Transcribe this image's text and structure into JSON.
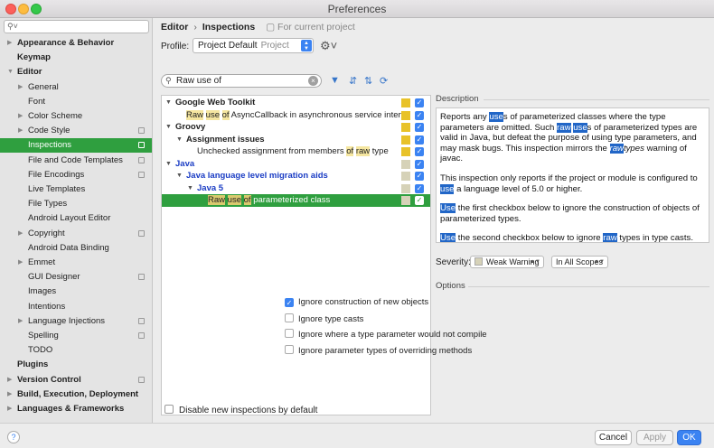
{
  "window": {
    "title": "Preferences"
  },
  "sidebar": {
    "search_placeholder": "",
    "items": [
      {
        "label": "Appearance & Behavior",
        "level": 0,
        "bold": true,
        "arrow": true,
        "page_icon": false
      },
      {
        "label": "Keymap",
        "level": 0,
        "bold": true,
        "arrow": false,
        "page_icon": false
      },
      {
        "label": "Editor",
        "level": 0,
        "bold": true,
        "arrow": true,
        "expanded": true,
        "page_icon": false
      },
      {
        "label": "General",
        "level": 1,
        "arrow": true,
        "page_icon": false
      },
      {
        "label": "Font",
        "level": 1,
        "arrow": false,
        "page_icon": false
      },
      {
        "label": "Color Scheme",
        "level": 1,
        "arrow": true,
        "page_icon": false
      },
      {
        "label": "Code Style",
        "level": 1,
        "arrow": true,
        "page_icon": true
      },
      {
        "label": "Inspections",
        "level": 1,
        "arrow": false,
        "page_icon": true,
        "selected": true
      },
      {
        "label": "File and Code Templates",
        "level": 1,
        "arrow": false,
        "page_icon": true
      },
      {
        "label": "File Encodings",
        "level": 1,
        "arrow": false,
        "page_icon": true
      },
      {
        "label": "Live Templates",
        "level": 1,
        "arrow": false,
        "page_icon": false
      },
      {
        "label": "File Types",
        "level": 1,
        "arrow": false,
        "page_icon": false
      },
      {
        "label": "Android Layout Editor",
        "level": 1,
        "arrow": false,
        "page_icon": false
      },
      {
        "label": "Copyright",
        "level": 1,
        "arrow": true,
        "page_icon": true
      },
      {
        "label": "Android Data Binding",
        "level": 1,
        "arrow": false,
        "page_icon": false
      },
      {
        "label": "Emmet",
        "level": 1,
        "arrow": true,
        "page_icon": false
      },
      {
        "label": "GUI Designer",
        "level": 1,
        "arrow": false,
        "page_icon": true
      },
      {
        "label": "Images",
        "level": 1,
        "arrow": false,
        "page_icon": false
      },
      {
        "label": "Intentions",
        "level": 1,
        "arrow": false,
        "page_icon": false
      },
      {
        "label": "Language Injections",
        "level": 1,
        "arrow": true,
        "page_icon": true
      },
      {
        "label": "Spelling",
        "level": 1,
        "arrow": false,
        "page_icon": true
      },
      {
        "label": "TODO",
        "level": 1,
        "arrow": false,
        "page_icon": false
      },
      {
        "label": "Plugins",
        "level": 0,
        "bold": true,
        "arrow": false,
        "page_icon": false
      },
      {
        "label": "Version Control",
        "level": 0,
        "bold": true,
        "arrow": true,
        "page_icon": true
      },
      {
        "label": "Build, Execution, Deployment",
        "level": 0,
        "bold": true,
        "arrow": true,
        "page_icon": false
      },
      {
        "label": "Languages & Frameworks",
        "level": 0,
        "bold": true,
        "arrow": true,
        "page_icon": false
      }
    ]
  },
  "header": {
    "breadcrumb_root": "Editor",
    "breadcrumb_sep": "›",
    "breadcrumb_page": "Inspections",
    "scope_note": "For current project",
    "profile_label": "Profile:",
    "profile_value": "Project Default",
    "profile_sub": "Project"
  },
  "filter": {
    "value": "Raw use of"
  },
  "tree": {
    "rows": [
      {
        "depth": 0,
        "arrow": "▼",
        "bold": true,
        "blue": false,
        "parts": [
          [
            "Google Web Toolkit",
            ""
          ]
        ],
        "severity": "warning"
      },
      {
        "depth": 1,
        "arrow": "",
        "parts": [
          [
            "Raw",
            "hl"
          ],
          [
            " ",
            ""
          ],
          [
            "use",
            "hl"
          ],
          [
            " ",
            ""
          ],
          [
            "of",
            "hl"
          ],
          [
            " AsyncCallback in asynchronous service interf",
            ""
          ]
        ],
        "severity": "warning"
      },
      {
        "depth": 0,
        "arrow": "▼",
        "bold": true,
        "parts": [
          [
            "Groovy",
            ""
          ]
        ],
        "severity": "warning"
      },
      {
        "depth": 1,
        "arrow": "▼",
        "bold": true,
        "parts": [
          [
            "Assignment issues",
            ""
          ]
        ],
        "severity": "warning"
      },
      {
        "depth": 2,
        "arrow": "",
        "parts": [
          [
            "Unchecked assignment from members ",
            ""
          ],
          [
            "of",
            "hl"
          ],
          [
            " ",
            ""
          ],
          [
            "raw",
            "hl"
          ],
          [
            " type",
            ""
          ]
        ],
        "severity": "warning"
      },
      {
        "depth": 0,
        "arrow": "▼",
        "bold": true,
        "blue": true,
        "parts": [
          [
            "Java",
            ""
          ]
        ],
        "severity": "weak"
      },
      {
        "depth": 1,
        "arrow": "▼",
        "bold": true,
        "blue": true,
        "parts": [
          [
            "Java language level migration aids",
            ""
          ]
        ],
        "severity": "weak"
      },
      {
        "depth": 2,
        "arrow": "▼",
        "bold": true,
        "blue": true,
        "parts": [
          [
            "Java 5",
            ""
          ]
        ],
        "severity": "weak"
      },
      {
        "depth": 3,
        "arrow": "",
        "selected": true,
        "parts": [
          [
            "Raw",
            "hl g"
          ],
          [
            " ",
            ""
          ],
          [
            "use",
            "hl g"
          ],
          [
            " ",
            ""
          ],
          [
            "of",
            "hl g"
          ],
          [
            " parameterized class",
            ""
          ]
        ],
        "severity": "weak"
      }
    ],
    "disable_new_label": "Disable new inspections by default"
  },
  "description": {
    "title": "Description",
    "paragraphs": [
      [
        [
          "Reports any ",
          ""
        ],
        [
          "use",
          "mk"
        ],
        [
          "s of parameterized classes where the type parameters are omitted. Such ",
          ""
        ],
        [
          "raw",
          "mk"
        ],
        [
          " ",
          ""
        ],
        [
          "use",
          "mk"
        ],
        [
          "s of parameterized types are valid in Java, but defeat the purpose of using type parameters, and may mask bugs. This inspection mirrors the ",
          ""
        ],
        [
          "raw",
          "mk it"
        ],
        [
          "types",
          "it"
        ],
        [
          " warning of javac.",
          ""
        ]
      ],
      [
        [
          "This inspection only reports if the project or module is configured to ",
          ""
        ],
        [
          "use",
          "mk"
        ],
        [
          " a language level of 5.0 or higher.",
          ""
        ]
      ],
      [
        [
          "Use",
          "mk"
        ],
        [
          " the first checkbox below to ignore the construction of objects of parameterized types.",
          ""
        ]
      ],
      [
        [
          "Use",
          "mk"
        ],
        [
          " the second checkbox below to ignore ",
          ""
        ],
        [
          "raw",
          "mk"
        ],
        [
          " types in type casts.",
          ""
        ]
      ]
    ]
  },
  "severity": {
    "label": "Severity:",
    "value": "Weak Warning",
    "scope": "In All Scopes"
  },
  "options": {
    "title": "Options",
    "items": [
      {
        "label": "Ignore construction of new objects",
        "checked": true
      },
      {
        "label": "Ignore type casts",
        "checked": false
      },
      {
        "label": "Ignore where a type parameter would not compile",
        "checked": false
      },
      {
        "label": "Ignore parameter types of overriding methods",
        "checked": false
      }
    ]
  },
  "buttons": {
    "help": "?",
    "cancel": "Cancel",
    "apply": "Apply",
    "ok": "OK"
  },
  "colors": {
    "selection_green": "#2f9f3f",
    "accent_blue": "#3b83f2",
    "warning_yellow": "#e8c229",
    "weak_warning": "#d6d2b8"
  }
}
